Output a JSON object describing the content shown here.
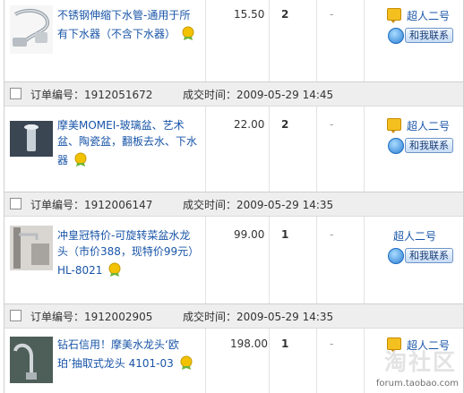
{
  "orders": [
    {
      "title": "不锈钢伸缩下水管-通用于所有下水器（不含下水器）",
      "price": "15.50",
      "qty": "2",
      "status": "-",
      "seller": "超人二号",
      "contact": "和我联系"
    },
    {
      "order_label": "订单编号：",
      "order_no": "1912051672",
      "time_label": "成交时间：",
      "time": "2009-05-29 14:45",
      "title": "摩美MOMEI-玻璃盆、艺术盆、陶瓷盆，翻板去水、下水器",
      "price": "22.00",
      "qty": "2",
      "status": "-",
      "seller": "超人二号",
      "contact": "和我联系"
    },
    {
      "order_label": "订单编号：",
      "order_no": "1912006147",
      "time_label": "成交时间：",
      "time": "2009-05-29 14:35",
      "title": "冲皇冠特价-可旋转菜盆水龙头（市价388，现特价99元）HL-8021",
      "price": "99.00",
      "qty": "1",
      "status": "-",
      "seller": "超人二号",
      "contact": "和我联系"
    },
    {
      "order_label": "订单编号：",
      "order_no": "1912002905",
      "time_label": "成交时间：",
      "time": "2009-05-29 14:35",
      "title": "钻石信用！摩美水龙头‘欧珀’抽取式龙头 4101-03",
      "price": "198.00",
      "qty": "1",
      "status": "-",
      "seller": "超人二号"
    }
  ],
  "watermark": {
    "logo": "淘社区",
    "url": "forum.taobao.com"
  },
  "colors": {
    "link": "#1955a8",
    "header_bg": "#eeeeee",
    "medal": "#f2c200",
    "leaf": "#6fb33a"
  }
}
